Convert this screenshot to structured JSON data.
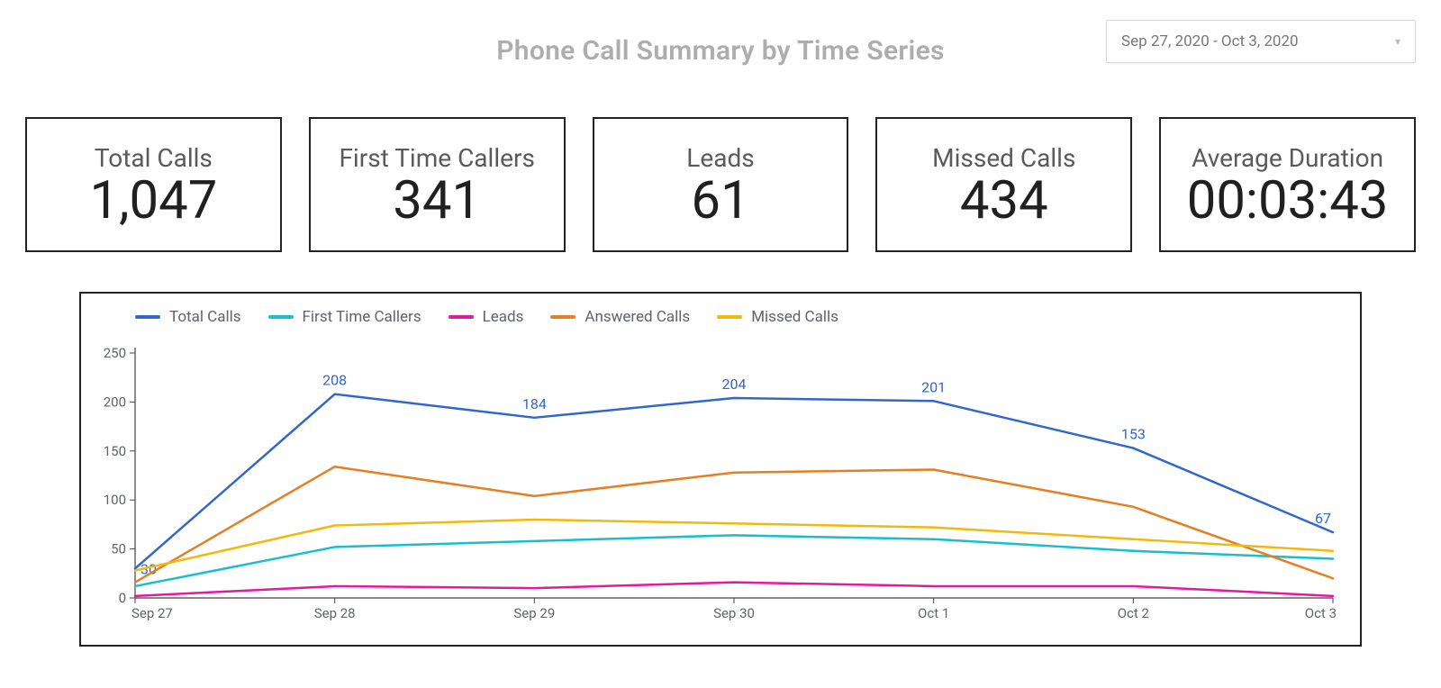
{
  "header": {
    "title": "Phone Call Summary by Time Series",
    "date_range": "Sep 27, 2020 - Oct 3, 2020"
  },
  "kpis": [
    {
      "label": "Total Calls",
      "value": "1,047"
    },
    {
      "label": "First Time Callers",
      "value": "341"
    },
    {
      "label": "Leads",
      "value": "61"
    },
    {
      "label": "Missed Calls",
      "value": "434"
    },
    {
      "label": "Average Duration",
      "value": "00:03:43"
    }
  ],
  "chart_data": {
    "type": "line",
    "categories": [
      "Sep 27",
      "Sep 28",
      "Sep 29",
      "Sep 30",
      "Oct 1",
      "Oct 2",
      "Oct 3"
    ],
    "y_ticks": [
      0,
      50,
      100,
      150,
      200,
      250
    ],
    "ylim": [
      0,
      250
    ],
    "xlabel": "",
    "ylabel": "",
    "title": "",
    "legend_position": "top",
    "series": [
      {
        "name": "Total Calls",
        "color": "#3366cc",
        "values": [
          30,
          208,
          184,
          204,
          201,
          153,
          67
        ],
        "show_labels": true
      },
      {
        "name": "First Time Callers",
        "color": "#17becf",
        "values": [
          12,
          52,
          58,
          64,
          60,
          48,
          40
        ],
        "show_labels": false
      },
      {
        "name": "Leads",
        "color": "#e31a9c",
        "values": [
          2,
          12,
          10,
          16,
          12,
          12,
          2
        ],
        "show_labels": false
      },
      {
        "name": "Answered Calls",
        "color": "#e67e22",
        "values": [
          16,
          134,
          104,
          128,
          131,
          93,
          20
        ],
        "show_labels": false
      },
      {
        "name": "Missed Calls",
        "color": "#f1b80e",
        "values": [
          28,
          74,
          80,
          76,
          72,
          60,
          48
        ],
        "show_labels": false
      }
    ]
  }
}
